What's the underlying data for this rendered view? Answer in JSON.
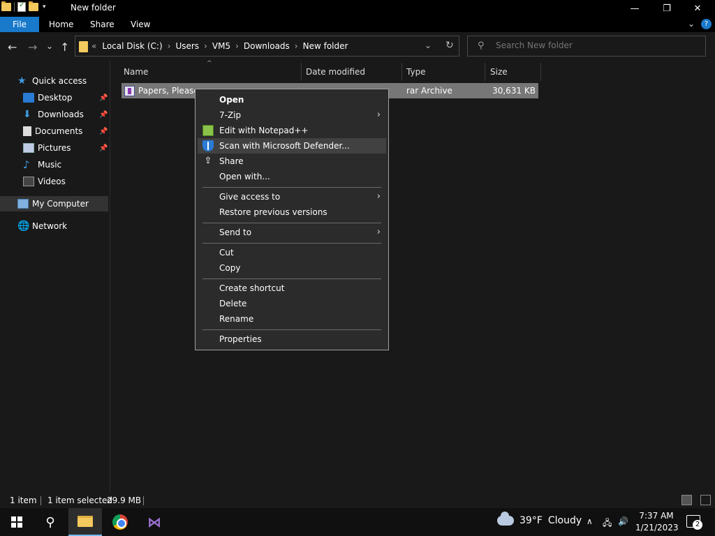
{
  "window": {
    "title": "New folder",
    "controls": {
      "minimize": "—",
      "maximize": "❐",
      "close": "✕"
    }
  },
  "ribbon": {
    "tabs": [
      "File",
      "Home",
      "Share",
      "View"
    ]
  },
  "nav": {
    "back": "←",
    "forward": "→",
    "recent": "⌄",
    "up": "↑",
    "breadcrumb_prefix": "«",
    "breadcrumbs": [
      "Local Disk (C:)",
      "Users",
      "VM5",
      "Downloads",
      "New folder"
    ]
  },
  "search": {
    "placeholder": "Search New folder"
  },
  "sidebar": {
    "quick_access": "Quick access",
    "items": [
      {
        "label": "Desktop",
        "pinned": true,
        "icon": "desktop-icon"
      },
      {
        "label": "Downloads",
        "pinned": true,
        "icon": "download-icon"
      },
      {
        "label": "Documents",
        "pinned": true,
        "icon": "documents-icon"
      },
      {
        "label": "Pictures",
        "pinned": true,
        "icon": "pictures-icon"
      },
      {
        "label": "Music",
        "pinned": false,
        "icon": "music-icon"
      },
      {
        "label": "Videos",
        "pinned": false,
        "icon": "videos-icon"
      }
    ],
    "my_computer": "My Computer",
    "network": "Network"
  },
  "columns": {
    "name": "Name",
    "date_modified": "Date modified",
    "type": "Type",
    "size": "Size"
  },
  "files": [
    {
      "name": "Papers, Please",
      "date_modified": "",
      "type": "rar Archive",
      "size": "30,631 KB",
      "selected": true
    }
  ],
  "context_menu": {
    "items": {
      "open": "Open",
      "seven_zip": "7-Zip",
      "edit_notepad": "Edit with Notepad++",
      "scan_defender": "Scan with Microsoft Defender...",
      "share": "Share",
      "open_with": "Open with...",
      "give_access": "Give access to",
      "restore_versions": "Restore previous versions",
      "send_to": "Send to",
      "cut": "Cut",
      "copy": "Copy",
      "create_shortcut": "Create shortcut",
      "delete": "Delete",
      "rename": "Rename",
      "properties": "Properties"
    },
    "highlighted": "Scan with Microsoft Defender..."
  },
  "status": {
    "count": "1 item",
    "selection": "1 item selected",
    "size": "29.9 MB"
  },
  "taskbar": {
    "weather_temp": "39°F",
    "weather_desc": "Cloudy",
    "time": "7:37 AM",
    "date": "1/21/2023",
    "notifications": "2"
  }
}
